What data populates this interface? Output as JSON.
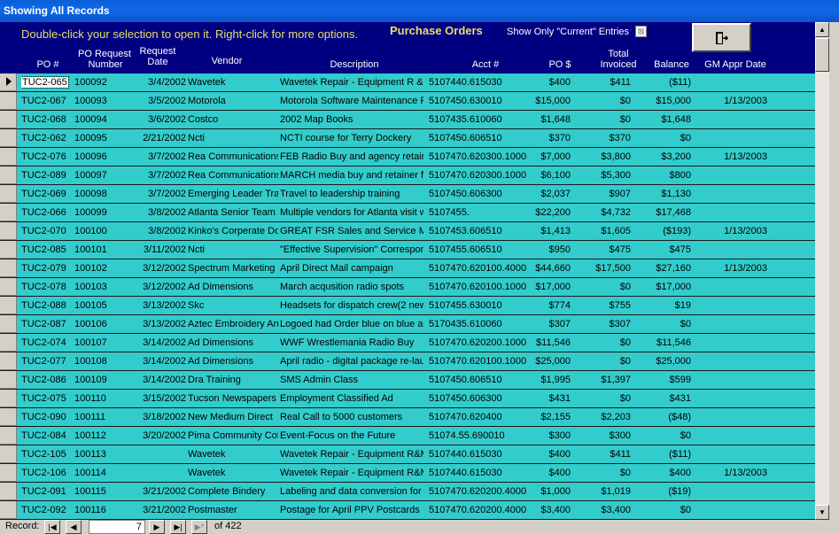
{
  "window": {
    "title": "Showing All Records"
  },
  "header": {
    "hint": "Double-click your selection to open it. Right-click for more options.",
    "form_title": "Purchase Orders",
    "current_label": "Show Only \"Current\" Entries"
  },
  "columns": {
    "po": "PO #",
    "req_line1": "PO Request",
    "req_line2": "Number",
    "date_line1": "Request",
    "date_line2": "Date",
    "vendor": "Vendor",
    "description": "Description",
    "acct": "Acct #",
    "po_amount": "PO $",
    "inv_line1": "Total",
    "inv_line2": "Invoiced",
    "balance": "Balance",
    "gm": "GM Appr Date"
  },
  "rows": [
    {
      "po": "TUC2-065",
      "req": "100092",
      "date": "3/4/2002",
      "vendor": "Wavetek",
      "desc": "Wavetek Repair - Equipment R &",
      "acct": "5107440.615030",
      "amt": "$400",
      "inv": "$411",
      "bal": "($11)",
      "gm": ""
    },
    {
      "po": "TUC2-067",
      "req": "100093",
      "date": "3/5/2002",
      "vendor": "Motorola",
      "desc": "Motorola Software Maintenance P",
      "acct": "5107450.630010",
      "amt": "$15,000",
      "inv": "$0",
      "bal": "$15,000",
      "gm": "1/13/2003"
    },
    {
      "po": "TUC2-068",
      "req": "100094",
      "date": "3/6/2002",
      "vendor": "Costco",
      "desc": "2002 Map Books",
      "acct": "5107435.610060",
      "amt": "$1,648",
      "inv": "$0",
      "bal": "$1,648",
      "gm": ""
    },
    {
      "po": "TUC2-062",
      "req": "100095",
      "date": "2/21/2002",
      "vendor": "Ncti",
      "desc": "NCTI course for Terry Dockery",
      "acct": "5107450.606510",
      "amt": "$370",
      "inv": "$370",
      "bal": "$0",
      "gm": ""
    },
    {
      "po": "TUC2-076",
      "req": "100096",
      "date": "3/7/2002",
      "vendor": "Rea Communications",
      "desc": "FEB Radio Buy and agency retain",
      "acct": "5107470.620300.1000",
      "amt": "$7,000",
      "inv": "$3,800",
      "bal": "$3,200",
      "gm": "1/13/2003"
    },
    {
      "po": "TUC2-089",
      "req": "100097",
      "date": "3/7/2002",
      "vendor": "Rea Communications",
      "desc": "MARCH media buy and retainer fe",
      "acct": "5107470.620300.1000",
      "amt": "$6,100",
      "inv": "$5,300",
      "bal": "$800",
      "gm": ""
    },
    {
      "po": "TUC2-069",
      "req": "100098",
      "date": "3/7/2002",
      "vendor": "Emerging Leader Trai",
      "desc": "Travel to leadership training",
      "acct": "5107450.606300",
      "amt": "$2,037",
      "inv": "$907",
      "bal": "$1,130",
      "gm": ""
    },
    {
      "po": "TUC2-066",
      "req": "100099",
      "date": "3/8/2002",
      "vendor": "Atlanta Senior Team V",
      "desc": "Multiple vendors for Atlanta visit w",
      "acct": "5107455.",
      "amt": "$22,200",
      "inv": "$4,732",
      "bal": "$17,468",
      "gm": ""
    },
    {
      "po": "TUC2-070",
      "req": "100100",
      "date": "3/8/2002",
      "vendor": "Kinko's Corperate Do",
      "desc": "GREAT FSR Sales and Service M",
      "acct": "5107453.606510",
      "amt": "$1,413",
      "inv": "$1,605",
      "bal": "($193)",
      "gm": "1/13/2003"
    },
    {
      "po": "TUC2-085",
      "req": "100101",
      "date": "3/11/2002",
      "vendor": "Ncti",
      "desc": "\"Effective Supervision\" Correspon",
      "acct": "5107455.606510",
      "amt": "$950",
      "inv": "$475",
      "bal": "$475",
      "gm": ""
    },
    {
      "po": "TUC2-079",
      "req": "100102",
      "date": "3/12/2002",
      "vendor": "Spectrum Marketing",
      "desc": "April Direct Mail campaign",
      "acct": "5107470.620100.4000",
      "amt": "$44,660",
      "inv": "$17,500",
      "bal": "$27,160",
      "gm": "1/13/2003"
    },
    {
      "po": "TUC2-078",
      "req": "100103",
      "date": "3/12/2002",
      "vendor": "Ad Dimensions",
      "desc": "March acqusition radio spots",
      "acct": "5107470.620100.1000",
      "amt": "$17,000",
      "inv": "$0",
      "bal": "$17,000",
      "gm": ""
    },
    {
      "po": "TUC2-088",
      "req": "100105",
      "date": "3/13/2002",
      "vendor": "Skc",
      "desc": "Headsets for dispatch crew(2 new",
      "acct": "5107455.630010",
      "amt": "$774",
      "inv": "$755",
      "bal": "$19",
      "gm": ""
    },
    {
      "po": "TUC2-087",
      "req": "100106",
      "date": "3/13/2002",
      "vendor": "Aztec Embroidery And",
      "desc": "Logoed had Order blue on blue ar",
      "acct": "5170435.610060",
      "amt": "$307",
      "inv": "$307",
      "bal": "$0",
      "gm": ""
    },
    {
      "po": "TUC2-074",
      "req": "100107",
      "date": "3/14/2002",
      "vendor": "Ad Dimensions",
      "desc": "WWF Wrestlemania Radio Buy",
      "acct": "5107470.620200.1000",
      "amt": "$11,546",
      "inv": "$0",
      "bal": "$11,546",
      "gm": ""
    },
    {
      "po": "TUC2-077",
      "req": "100108",
      "date": "3/14/2002",
      "vendor": "Ad Dimensions",
      "desc": "April radio - digital package re-laur",
      "acct": "5107470.620100.1000",
      "amt": "$25,000",
      "inv": "$0",
      "bal": "$25,000",
      "gm": ""
    },
    {
      "po": "TUC2-086",
      "req": "100109",
      "date": "3/14/2002",
      "vendor": "Dra Training",
      "desc": "SMS Admin Class",
      "acct": "5107450.606510",
      "amt": "$1,995",
      "inv": "$1,397",
      "bal": "$599",
      "gm": ""
    },
    {
      "po": "TUC2-075",
      "req": "100110",
      "date": "3/15/2002",
      "vendor": "Tucson Newspapers",
      "desc": "Employment Classified Ad",
      "acct": "5107450.606300",
      "amt": "$431",
      "inv": "$0",
      "bal": "$431",
      "gm": ""
    },
    {
      "po": "TUC2-090",
      "req": "100111",
      "date": "3/18/2002",
      "vendor": "New Medium Direct",
      "desc": "Real Call to 5000 customers",
      "acct": "5107470.620400",
      "amt": "$2,155",
      "inv": "$2,203",
      "bal": "($48)",
      "gm": ""
    },
    {
      "po": "TUC2-084",
      "req": "100112",
      "date": "3/20/2002",
      "vendor": "Pima Community Colle",
      "desc": "Event-Focus on the Future",
      "acct": "51074.55.690010",
      "amt": "$300",
      "inv": "$300",
      "bal": "$0",
      "gm": ""
    },
    {
      "po": "TUC2-105",
      "req": "100113",
      "date": "",
      "vendor": "Wavetek",
      "desc": "Wavetek Repair - Equipment R&M",
      "acct": "5107440.615030",
      "amt": "$400",
      "inv": "$411",
      "bal": "($11)",
      "gm": ""
    },
    {
      "po": "TUC2-106",
      "req": "100114",
      "date": "",
      "vendor": "Wavetek",
      "desc": "Wavetek Repair - Equipment R&M",
      "acct": "5107440.615030",
      "amt": "$400",
      "inv": "$0",
      "bal": "$400",
      "gm": "1/13/2003"
    },
    {
      "po": "TUC2-091",
      "req": "100115",
      "date": "3/21/2002",
      "vendor": "Complete Bindery",
      "desc": "Labeling and data conversion for A",
      "acct": "5107470.620200.4000",
      "amt": "$1,000",
      "inv": "$1,019",
      "bal": "($19)",
      "gm": ""
    },
    {
      "po": "TUC2-092",
      "req": "100116",
      "date": "3/21/2002",
      "vendor": "Postmaster",
      "desc": "Postage for April PPV Postcards",
      "acct": "5107470.620200.4000",
      "amt": "$3,400",
      "inv": "$3,400",
      "bal": "$0",
      "gm": ""
    }
  ],
  "navigation": {
    "label": "Record:",
    "current": "7",
    "of_label": "of",
    "total": "422"
  }
}
